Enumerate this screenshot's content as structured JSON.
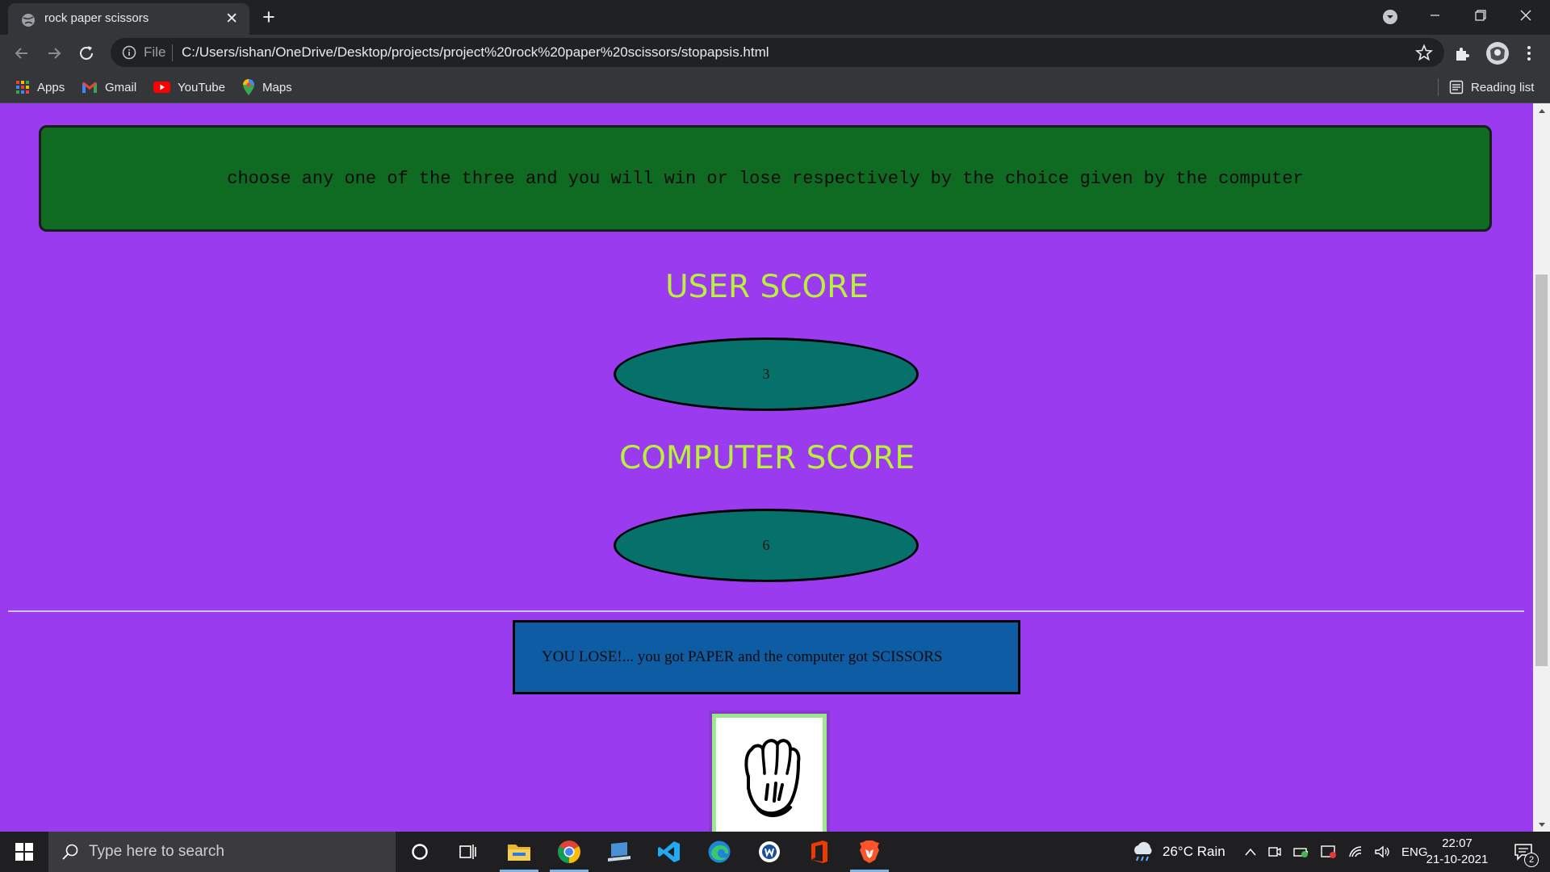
{
  "browser": {
    "tab_title": "rock paper scissors",
    "omnibox_scheme": "File",
    "url": "C:/Users/ishan/OneDrive/Desktop/projects/project%20rock%20paper%20scissors/stopapsis.html",
    "bookmarks": [
      {
        "label": "Apps",
        "icon": "apps-grid-icon"
      },
      {
        "label": "Gmail",
        "icon": "gmail-icon"
      },
      {
        "label": "YouTube",
        "icon": "youtube-icon"
      },
      {
        "label": "Maps",
        "icon": "maps-icon"
      }
    ],
    "reading_list": "Reading list"
  },
  "page": {
    "instruction": "choose any one of the three and you will win or lose respectively by the choice given by the computer",
    "user_score_label": "USER SCORE",
    "user_score": "3",
    "computer_score_label": "COMPUTER SCORE",
    "computer_score": "6",
    "result": "YOU LOSE!... you got PAPER and the computer got SCISSORS",
    "choice_image": "paper-hand-icon"
  },
  "taskbar": {
    "search_placeholder": "Type here to search",
    "weather": "26°C  Rain",
    "language": "ENG",
    "time": "22:07",
    "date": "21-10-2021",
    "notification_count": "2"
  },
  "colors": {
    "page_background": "#9a3bf0",
    "instruction_box": "#0e6b21",
    "score_heading": "#b9f03c",
    "score_oval": "#06706a",
    "result_box": "#0e5ca3"
  }
}
